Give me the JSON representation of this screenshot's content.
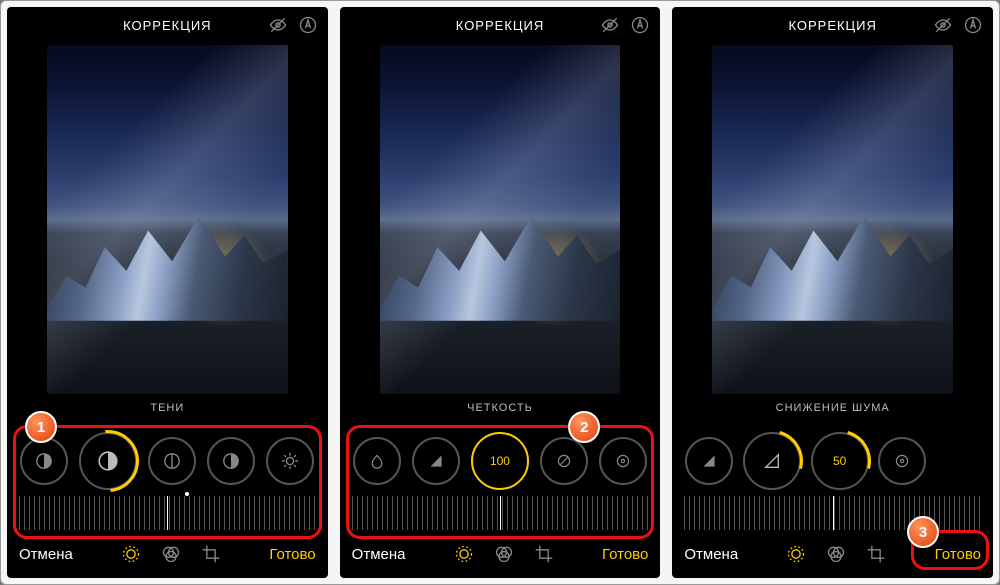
{
  "screens": [
    {
      "tab": "КОРРЕКЦИЯ",
      "param": "ТЕНИ",
      "centerValue": "",
      "dotOffset": "56%",
      "dials": [
        "half",
        "half",
        "half",
        "contrast",
        "sun"
      ],
      "active": 1
    },
    {
      "tab": "КОРРЕКЦИЯ",
      "param": "ЧЕТКОСТЬ",
      "centerValue": "100",
      "dotOffset": "",
      "dials": [
        "drop",
        "tri",
        "val",
        "dia",
        "circ"
      ],
      "active": 2
    },
    {
      "tab": "КОРРЕКЦИЯ",
      "param": "СНИЖЕНИЕ ШУМА",
      "centerValue": "50",
      "dotOffset": "",
      "dials": [
        "tri",
        "tri2",
        "val",
        "circ",
        "none"
      ],
      "active": 2
    }
  ],
  "footer": {
    "cancel": "Отмена",
    "done": "Готово"
  },
  "badges": [
    "1",
    "2",
    "3"
  ]
}
